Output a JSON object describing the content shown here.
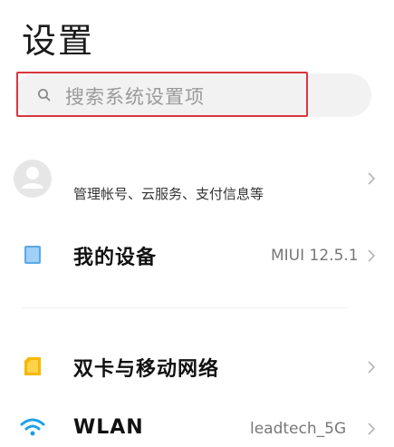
{
  "header": {
    "title": "设置"
  },
  "search": {
    "placeholder": "搜索系统设置项"
  },
  "account": {
    "subtitle": "管理帐号、云服务、支付信息等"
  },
  "device": {
    "label": "我的设备",
    "value": "MIUI 12.5.1"
  },
  "sim": {
    "label": "双卡与移动网络"
  },
  "wlan": {
    "label": "WLAN",
    "value": "leadtech_5G"
  },
  "colors": {
    "highlight": "#d9363e",
    "device_icon": "#5aa9e6",
    "sim_icon": "#f5b900",
    "wlan_icon": "#1ea1e6"
  }
}
